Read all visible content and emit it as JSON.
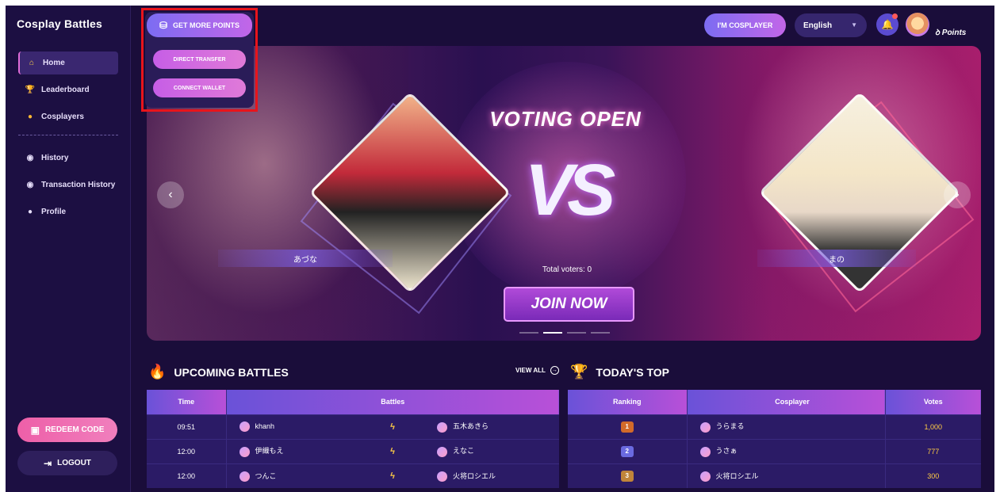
{
  "brand": "Cosplay Battles",
  "sidebar": {
    "items": [
      {
        "label": "Home",
        "icon": "home-icon"
      },
      {
        "label": "Leaderboard",
        "icon": "trophy-icon"
      },
      {
        "label": "Cosplayers",
        "icon": "cosplayers-icon"
      },
      {
        "label": "History",
        "icon": "history-icon"
      },
      {
        "label": "Transaction History",
        "icon": "transaction-icon"
      },
      {
        "label": "Profile",
        "icon": "profile-icon"
      }
    ],
    "redeem_label": "REDEEM CODE",
    "logout_label": "LOGOUT"
  },
  "topbar": {
    "get_points_label": "GET MORE POINTS",
    "dropdown": {
      "direct_transfer": "DIRECT TRANSFER",
      "connect_wallet": "CONNECT WALLET"
    },
    "cosplayer_label": "I'M COSPLAYER",
    "language": "English",
    "points_label": "Points"
  },
  "banner": {
    "title": "VOTING OPEN",
    "vs_text": "VS",
    "left_name": "あづな",
    "right_name": "まの",
    "total_voters": "Total voters: 0",
    "join_label": "JOIN NOW",
    "active_slide": 2,
    "slide_count": 4
  },
  "upcoming": {
    "title": "UPCOMING BATTLES",
    "view_all": "VIEW ALL",
    "columns": {
      "time": "Time",
      "battles": "Battles"
    },
    "rows": [
      {
        "time": "09:51",
        "p1": "khanh",
        "p2": "五木あきら"
      },
      {
        "time": "12:00",
        "p1": "伊織もえ",
        "p2": "えなこ"
      },
      {
        "time": "12:00",
        "p1": "つんこ",
        "p2": "火将ロシエル"
      }
    ]
  },
  "today_top": {
    "title": "TODAY'S TOP",
    "columns": {
      "ranking": "Ranking",
      "cosplayer": "Cosplayer",
      "votes": "Votes"
    },
    "rows": [
      {
        "rank": "1",
        "name": "うらまる",
        "votes": "1,000"
      },
      {
        "rank": "2",
        "name": "うさぁ",
        "votes": "777"
      },
      {
        "rank": "3",
        "name": "火将ロシエル",
        "votes": "300"
      }
    ]
  },
  "colors": {
    "background": "#1a0d3a",
    "accent_pink": "#ee5fa8",
    "accent_purple": "#7c6cf2",
    "highlight_box": "#e8141b",
    "vote_yellow": "#ffcc44"
  }
}
